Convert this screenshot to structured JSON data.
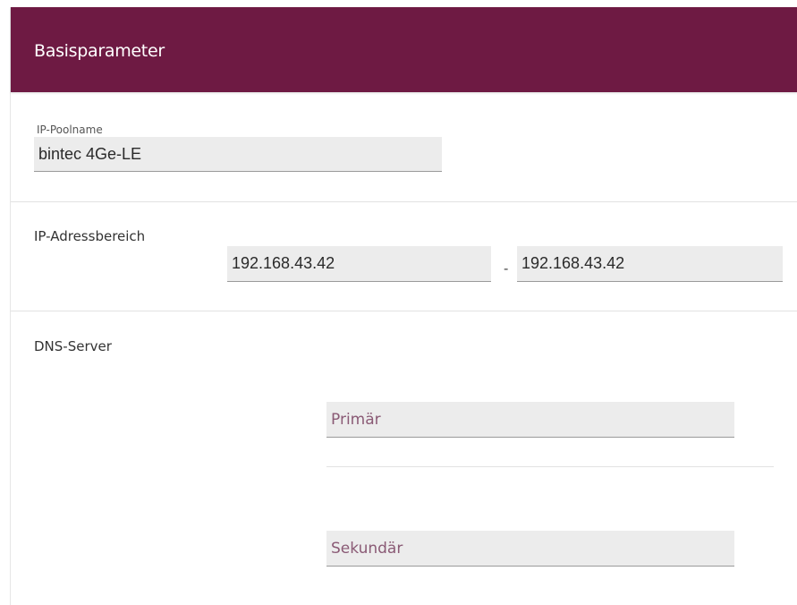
{
  "header": {
    "title": "Basisparameter"
  },
  "pool_name": {
    "label": "IP-Poolname",
    "value": "bintec 4Ge-LE"
  },
  "address_range": {
    "label": "IP-Adressbereich",
    "start": "192.168.43.42",
    "separator": "-",
    "end": "192.168.43.42"
  },
  "dns": {
    "label": "DNS-Server",
    "primary_placeholder": "Primär",
    "secondary_placeholder": "Sekundär"
  },
  "colors": {
    "header_bg": "#6e1a43",
    "input_bg": "#ececec",
    "placeholder": "#8a5a75"
  }
}
